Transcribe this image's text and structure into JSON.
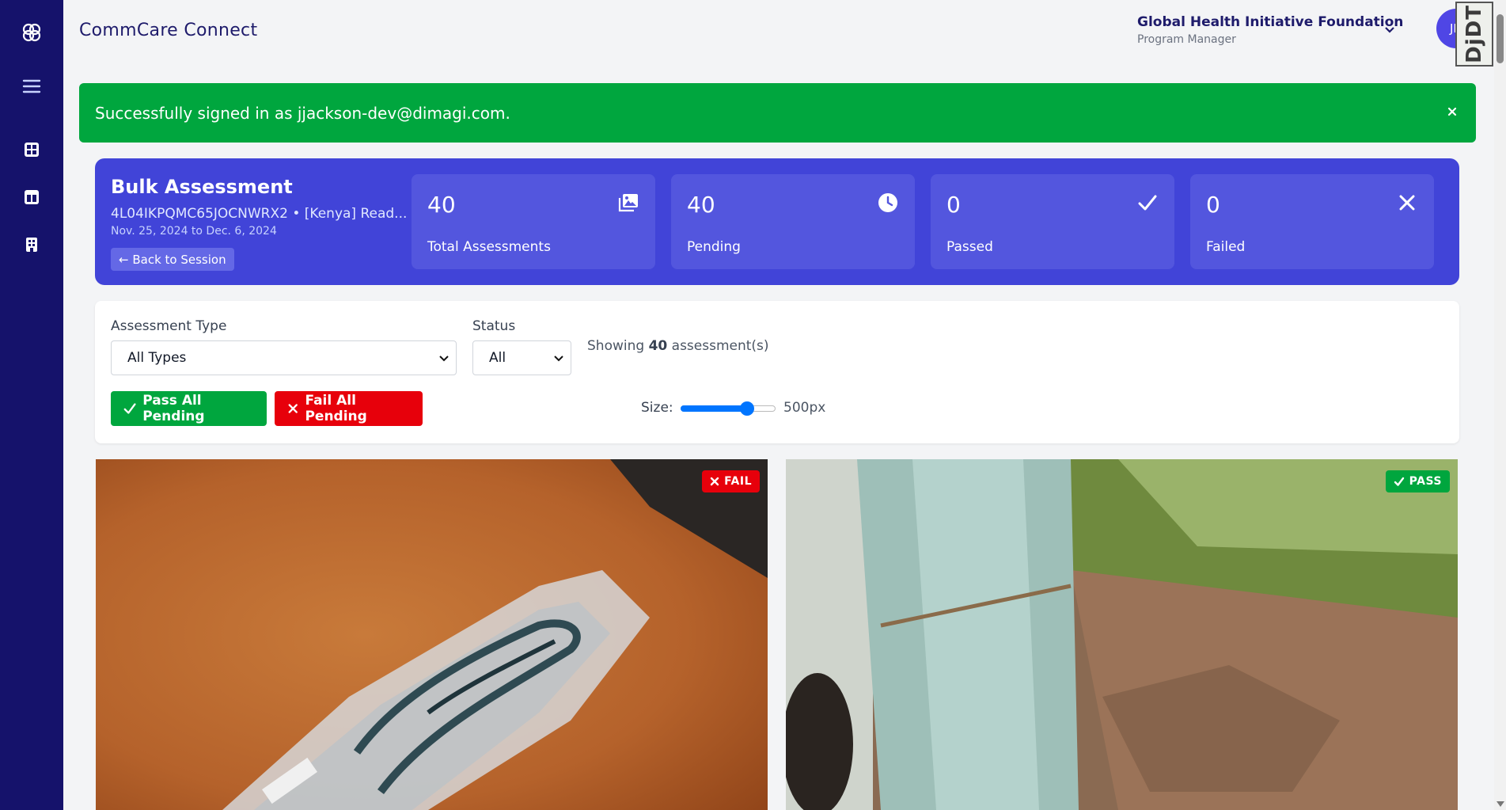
{
  "app": {
    "title": "CommCare Connect"
  },
  "header": {
    "org_name": "Global Health Initiative Foundation",
    "org_role": "Program Manager",
    "avatar_initials": "JD",
    "debug_toolbar_label": "DjDT"
  },
  "sidebar": {
    "items": [
      {
        "icon": "grid-icon"
      },
      {
        "icon": "layout-icon"
      },
      {
        "icon": "building-icon"
      }
    ]
  },
  "alert": {
    "message": "Successfully signed in as jjackson-dev@dimagi.com."
  },
  "hero": {
    "title": "Bulk Assessment",
    "subtitle": "4L04IKPQMC65JOCNWRX2 • [Kenya] Read...",
    "dates": "Nov. 25, 2024 to Dec. 6, 2024",
    "back_label": "← Back to Session"
  },
  "stats": [
    {
      "value": "40",
      "label": "Total Assessments",
      "icon": "images-icon"
    },
    {
      "value": "40",
      "label": "Pending",
      "icon": "clock-icon"
    },
    {
      "value": "0",
      "label": "Passed",
      "icon": "check-icon"
    },
    {
      "value": "0",
      "label": "Failed",
      "icon": "x-icon"
    }
  ],
  "filters": {
    "type_label": "Assessment Type",
    "type_value": "All Types",
    "status_label": "Status",
    "status_value": "All",
    "showing_prefix": "Showing",
    "showing_count": "40",
    "showing_suffix": "assessment(s)",
    "pass_all_label": "Pass All Pending",
    "fail_all_label": "Fail All Pending",
    "size_label": "Size:",
    "size_value": "500px",
    "size_fraction": 0.7
  },
  "assessments": [
    {
      "status": "FAIL",
      "photo": "eyeglasses in plastic bag on orange surface"
    },
    {
      "status": "PASS",
      "photo": "outdoor wall with grass and dirt path"
    }
  ],
  "colors": {
    "sidebar": "#15126b",
    "accent": "#4144d8",
    "success": "#00a63e",
    "danger": "#e7000b"
  }
}
